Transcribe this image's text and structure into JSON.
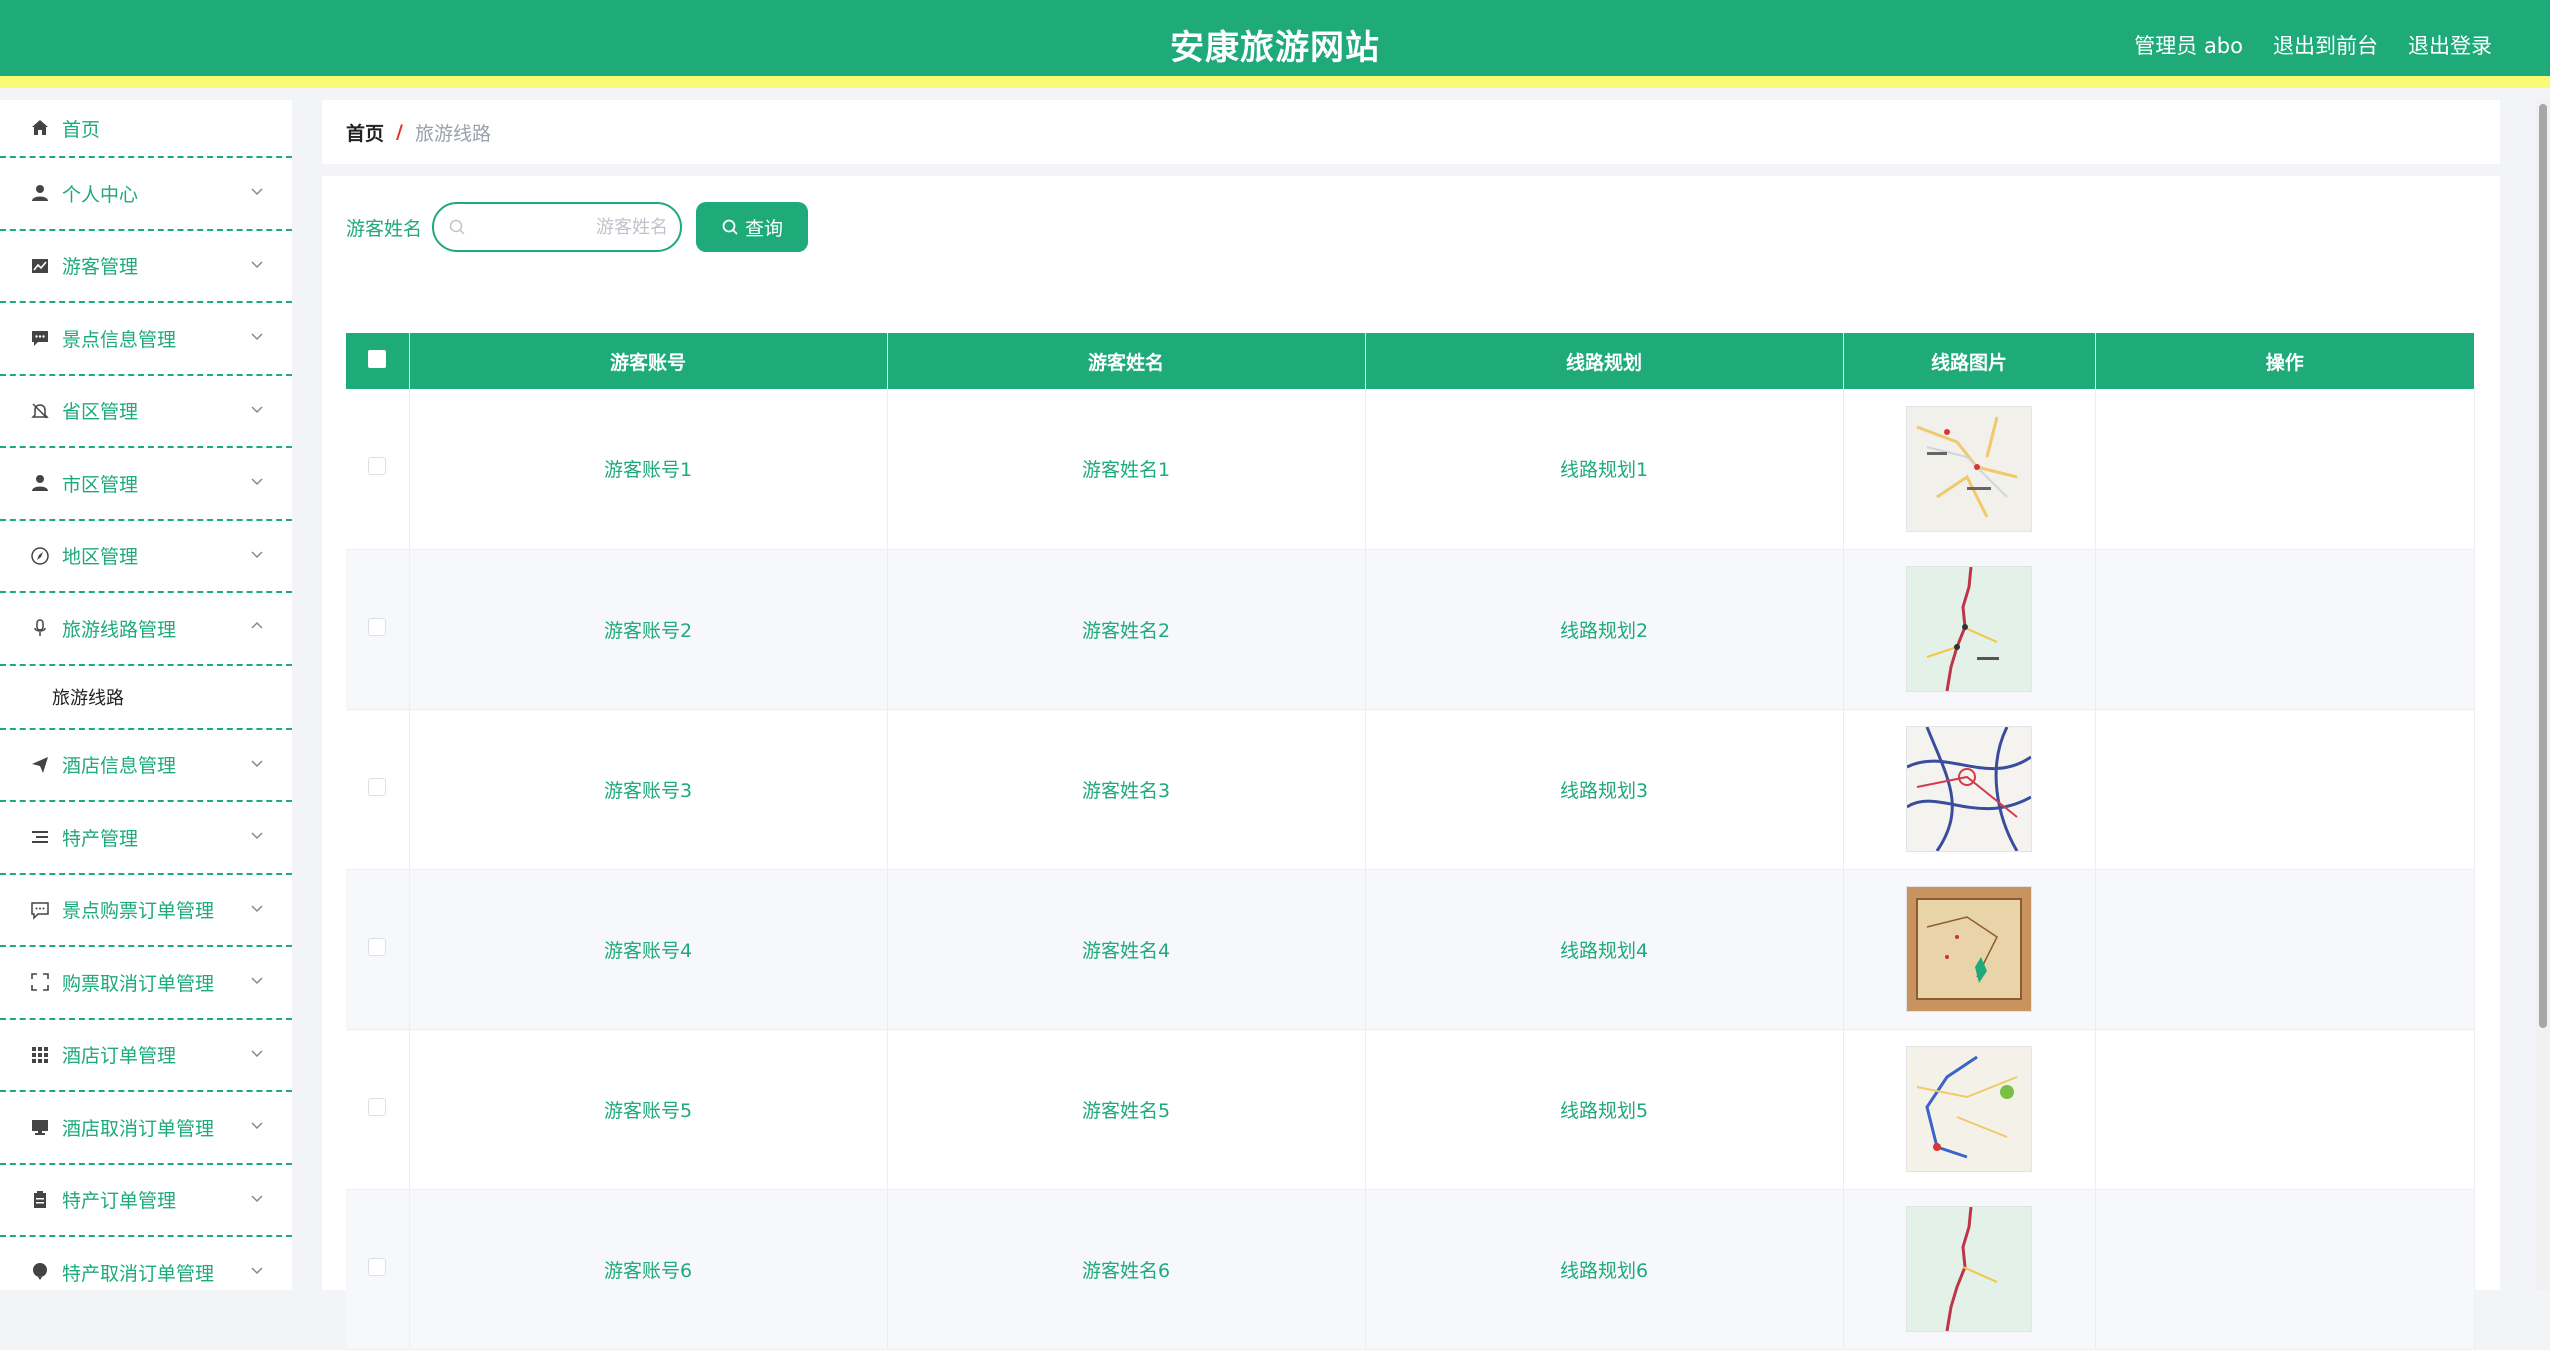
{
  "header": {
    "title": "安康旅游网站",
    "user_label": "管理员 abo",
    "front_link": "退出到前台",
    "logout_link": "退出登录"
  },
  "sidebar": {
    "items": [
      {
        "label": "首页",
        "icon": "home-icon"
      },
      {
        "label": "个人中心",
        "icon": "user-icon"
      },
      {
        "label": "游客管理",
        "icon": "chart-icon"
      },
      {
        "label": "景点信息管理",
        "icon": "chat-icon"
      },
      {
        "label": "省区管理",
        "icon": "bell-off-icon"
      },
      {
        "label": "市区管理",
        "icon": "user-icon"
      },
      {
        "label": "地区管理",
        "icon": "compass-icon"
      },
      {
        "label": "旅游线路管理",
        "icon": "microphone-icon"
      },
      {
        "label": "酒店信息管理",
        "icon": "send-icon"
      },
      {
        "label": "特产管理",
        "icon": "list-icon"
      },
      {
        "label": "景点购票订单管理",
        "icon": "message-icon"
      },
      {
        "label": "购票取消订单管理",
        "icon": "fullscreen-icon"
      },
      {
        "label": "酒店订单管理",
        "icon": "grid-icon"
      },
      {
        "label": "酒店取消订单管理",
        "icon": "monitor-icon"
      },
      {
        "label": "特产订单管理",
        "icon": "clipboard-icon"
      },
      {
        "label": "特产取消订单管理",
        "icon": "balloon-icon"
      }
    ],
    "submenu_label": "旅游线路"
  },
  "breadcrumb": {
    "home": "首页",
    "separator": "/",
    "current": "旅游线路"
  },
  "search": {
    "label": "游客姓名",
    "placeholder": "游客姓名",
    "button_label": "查询"
  },
  "table": {
    "columns": [
      "游客账号",
      "游客姓名",
      "线路规划",
      "线路图片",
      "操作"
    ],
    "rows": [
      {
        "account": "游客账号1",
        "name": "游客姓名1",
        "route": "线路规划1"
      },
      {
        "account": "游客账号2",
        "name": "游客姓名2",
        "route": "线路规划2"
      },
      {
        "account": "游客账号3",
        "name": "游客姓名3",
        "route": "线路规划3"
      },
      {
        "account": "游客账号4",
        "name": "游客姓名4",
        "route": "线路规划4"
      },
      {
        "account": "游客账号5",
        "name": "游客姓名5",
        "route": "线路规划5"
      },
      {
        "account": "游客账号6",
        "name": "游客姓名6",
        "route": "线路规划6"
      }
    ]
  },
  "colors": {
    "primary": "#1eaa79",
    "accent_stripe": "#fbfa76",
    "breadcrumb_separator": "#e0342c"
  }
}
